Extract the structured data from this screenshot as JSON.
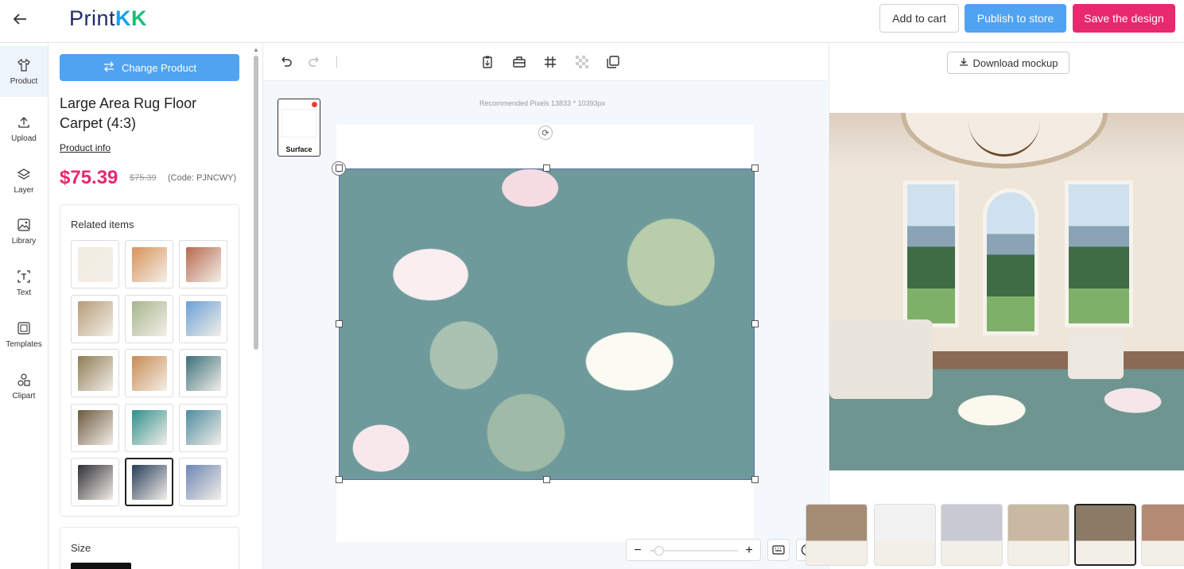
{
  "header": {
    "logo": {
      "part1": "Print",
      "k1": "K",
      "k2": "K"
    },
    "add_to_cart": "Add to cart",
    "publish": "Publish to store",
    "save": "Save the design",
    "colors": {
      "publish": "#4fa3f1",
      "save": "#e8286f"
    }
  },
  "rail": {
    "items": [
      {
        "label": "Product",
        "icon": "tshirt-icon",
        "active": true
      },
      {
        "label": "Upload",
        "icon": "upload-icon"
      },
      {
        "label": "Layer",
        "icon": "layers-icon"
      },
      {
        "label": "Library",
        "icon": "image-icon"
      },
      {
        "label": "Text",
        "icon": "text-icon"
      },
      {
        "label": "Templates",
        "icon": "templates-icon"
      },
      {
        "label": "Clipart",
        "icon": "shapes-icon"
      }
    ]
  },
  "product": {
    "change_label": "Change Product",
    "title": "Large Area Rug Floor Carpet (4:3)",
    "info_link": "Product info",
    "price": "$75.39",
    "old_price": "$75.39",
    "code": "(Code: PJNCWY)",
    "related_title": "Related items",
    "size_label": "Size",
    "related_colors": [
      "#f1ece0",
      "#d9925a",
      "#b66a4f",
      "#b79c78",
      "#a7b68d",
      "#6aa0d6",
      "#8f7c55",
      "#c98a53",
      "#3b6f7b",
      "#6e5a3f",
      "#2f8f8c",
      "#4f8ba0",
      "#2f2f36",
      "#273e5a",
      "#6d86b4"
    ],
    "selected_related": 13
  },
  "toolbar": {
    "icons": [
      "undo-icon",
      "redo-icon",
      "clipboard-icon",
      "toolbox-icon",
      "grid-icon",
      "transparency-icon",
      "duplicate-icon"
    ]
  },
  "canvas": {
    "surface_label": "Surface",
    "recommended": "Recommended Pixels 13833 * 10393px",
    "zoom_minus": "−",
    "zoom_plus": "+",
    "zoom_level": 0.1
  },
  "mockup": {
    "download_label": "Download mockup",
    "thumb_colors": [
      "#a58c74",
      "#f2f2f2",
      "#c9c9d3",
      "#c9b9a3",
      "#8a7a66",
      "#b48a74"
    ],
    "selected_thumb": 4
  }
}
